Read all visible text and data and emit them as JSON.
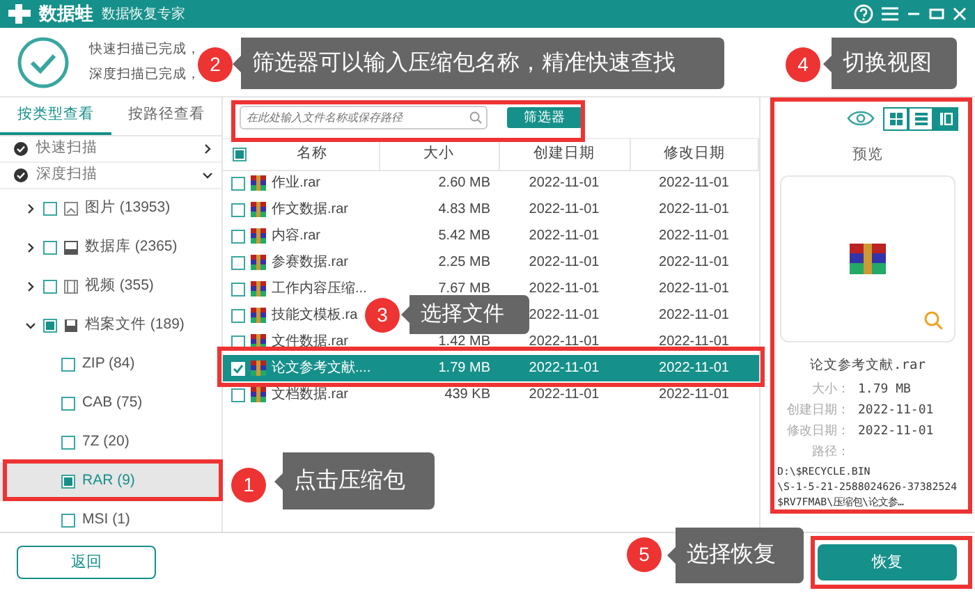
{
  "title_bar": {
    "app_name": "数据蛙",
    "subtitle": "数据恢复专家"
  },
  "scan_summary": [
    "快速扫描已完成，",
    "深度扫描已完成，"
  ],
  "sidebar": {
    "tabs": [
      {
        "label": "按类型查看",
        "selected": true
      },
      {
        "label": "按路径查看",
        "selected": false
      }
    ],
    "scans": [
      {
        "label": "快速扫描",
        "expanded": false
      },
      {
        "label": "深度扫描",
        "expanded": true
      }
    ],
    "tree": [
      {
        "label": "图片 (13953)",
        "kind": "image",
        "expanded": false,
        "checked": false,
        "indeterminate": false,
        "selected": false
      },
      {
        "label": "数据库 (2365)",
        "kind": "database",
        "expanded": false,
        "checked": false,
        "indeterminate": false,
        "selected": false
      },
      {
        "label": "视频 (355)",
        "kind": "video",
        "expanded": false,
        "checked": false,
        "indeterminate": false,
        "selected": false
      },
      {
        "label": "档案文件 (189)",
        "kind": "archive",
        "expanded": true,
        "checked": false,
        "indeterminate": true,
        "selected": false,
        "children": [
          {
            "label": "ZIP (84)",
            "checked": false,
            "indeterminate": false,
            "selected": false
          },
          {
            "label": "CAB (75)",
            "checked": false,
            "indeterminate": false,
            "selected": false
          },
          {
            "label": "7Z (20)",
            "checked": false,
            "indeterminate": false,
            "selected": false
          },
          {
            "label": "RAR (9)",
            "checked": false,
            "indeterminate": true,
            "selected": true
          },
          {
            "label": "MSI (1)",
            "checked": false,
            "indeterminate": false,
            "selected": false
          }
        ]
      }
    ]
  },
  "search": {
    "placeholder": "在此处输入文件名称或保存路径",
    "filter_button": "筛选器"
  },
  "table": {
    "header_indeterminate": true,
    "columns": [
      "名称",
      "大小",
      "创建日期",
      "修改日期"
    ],
    "rows": [
      {
        "name": "作业.rar",
        "size": "2.60 MB",
        "created": "2022-11-01",
        "modified": "2022-11-01",
        "checked": false,
        "selected": false
      },
      {
        "name": "作文数据.rar",
        "size": "4.83 MB",
        "created": "2022-11-01",
        "modified": "2022-11-01",
        "checked": false,
        "selected": false
      },
      {
        "name": "内容.rar",
        "size": "5.42 MB",
        "created": "2022-11-01",
        "modified": "2022-11-01",
        "checked": false,
        "selected": false
      },
      {
        "name": "参赛数据.rar",
        "size": "2.25 MB",
        "created": "2022-11-01",
        "modified": "2022-11-01",
        "checked": false,
        "selected": false
      },
      {
        "name": "工作内容压缩...",
        "size": "7.67 MB",
        "created": "2022-11-01",
        "modified": "2022-11-01",
        "checked": false,
        "selected": false
      },
      {
        "name": "技能文模板.ra",
        "created": "2022-11-01",
        "modified": "2022-11-01",
        "checked": false,
        "selected": false
      },
      {
        "name": "文件数据.rar",
        "size": "1.42 MB",
        "created": "2022-11-01",
        "modified": "2022-11-01",
        "checked": false,
        "selected": false
      },
      {
        "name": "论文参考文献....",
        "size": "1.79 MB",
        "created": "2022-11-01",
        "modified": "2022-11-01",
        "checked": true,
        "selected": true
      },
      {
        "name": "文档数据.rar",
        "size": "439 KB",
        "created": "2022-11-01",
        "modified": "2022-11-01",
        "checked": false,
        "selected": false
      }
    ]
  },
  "view_modes": [
    {
      "kind": "grid",
      "selected": false
    },
    {
      "kind": "list",
      "selected": false
    },
    {
      "kind": "preview",
      "selected": true
    }
  ],
  "preview": {
    "title": "预览",
    "file_name": "论文参考文献.rar",
    "fields": [
      {
        "label": "大小：",
        "value": "1.79 MB"
      },
      {
        "label": "创建日期：",
        "value": "2022-11-01"
      },
      {
        "label": "修改日期：",
        "value": "2022-11-01"
      },
      {
        "label": "路径："
      }
    ],
    "path": [
      "D:\\$RECYCLE.BIN",
      "\\S-1-5-21-2588024626-37382524",
      "$RV7FMAB\\压缩包\\论文参…"
    ]
  },
  "footer": {
    "back_button": "返回",
    "restore_button": "恢复"
  },
  "callouts": [
    {
      "number": "2",
      "text": "筛选器可以输入压缩包名称，精准快速查找",
      "kind": "filter"
    },
    {
      "number": "4",
      "text": "切换视图",
      "kind": "view"
    },
    {
      "number": "3",
      "text": "选择文件",
      "kind": "file"
    },
    {
      "number": "1",
      "text": "点击压缩包",
      "kind": "archive"
    },
    {
      "number": "5",
      "text": "选择恢复",
      "kind": "restore"
    }
  ]
}
